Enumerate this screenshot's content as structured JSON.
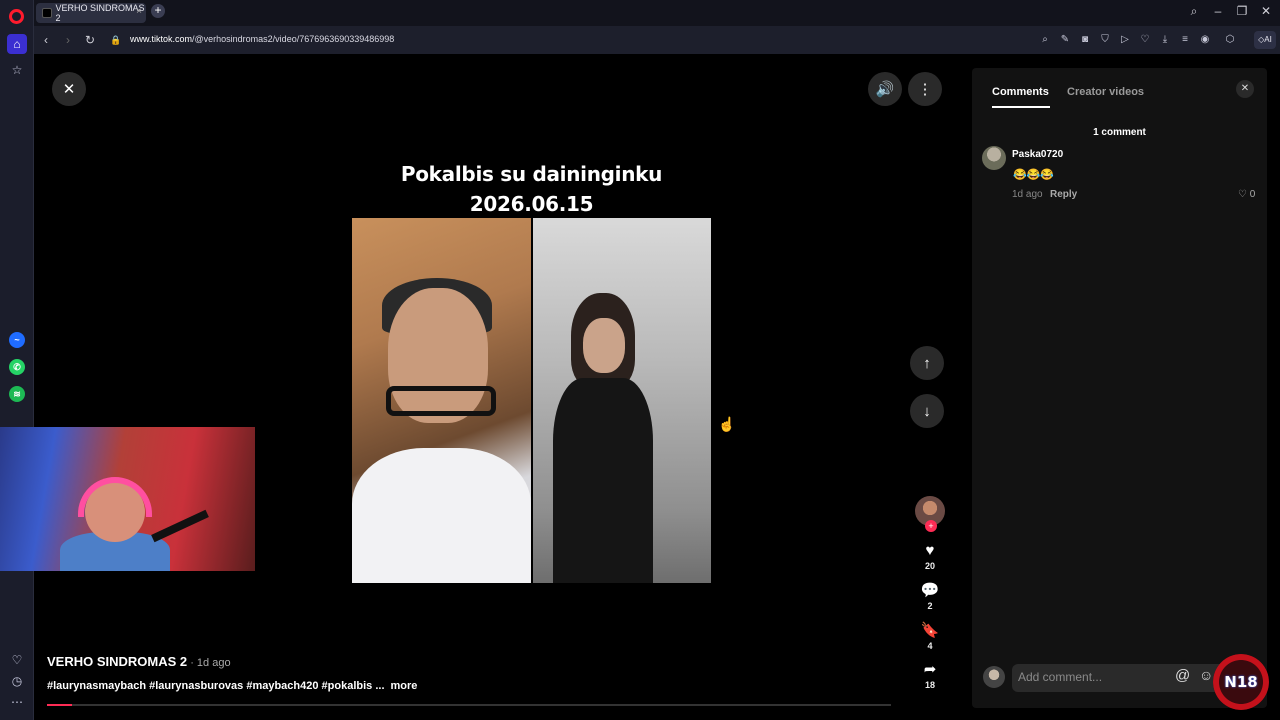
{
  "browser": {
    "tab_title": "VERHO SINDROMAS 2",
    "tab_close": "×",
    "new_tab": "+",
    "url_domain": "www.tiktok.com",
    "url_path": "/@verhosindromas2/video/7676963690339486998",
    "ai_label": "AI"
  },
  "video": {
    "overlay_line1": "Pokalbis su daininginku",
    "overlay_line2": "2026.06.15",
    "author": "VERHO SINDROMAS 2",
    "posted": " · 1d ago",
    "description": "#laurynasmaybach #laurynasburovas #maybach420 #pokalbis ...",
    "more_label": "more",
    "progress_fraction": 0.03,
    "likes": "20",
    "comments": "2",
    "saves": "4",
    "shares": "18"
  },
  "panel": {
    "tab_comments": "Comments",
    "tab_creator_videos": "Creator videos",
    "comment_count": "1 comment",
    "comments": [
      {
        "user": "Paska0720",
        "text": "😂😂😂",
        "time": "1d ago",
        "reply_label": "Reply",
        "likes": "0"
      }
    ],
    "compose_placeholder": "Add comment...",
    "compose_at": "@",
    "compose_emoji": "☺"
  },
  "watermark": {
    "logo_text": "N18"
  },
  "colors": {
    "accent": "#fe2c55",
    "opera_red": "#ff1b2d",
    "sidebar_active": "#3b2fd1"
  }
}
